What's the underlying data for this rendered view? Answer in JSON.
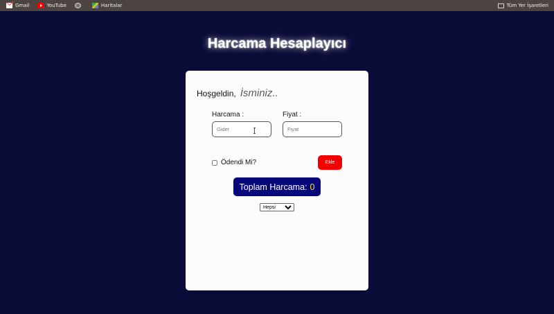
{
  "bookmarks": {
    "items": [
      {
        "label": "Gmail",
        "icon": "gmail-icon"
      },
      {
        "label": "YouTube",
        "icon": "youtube-icon"
      },
      {
        "label": "",
        "icon": "globe-icon"
      },
      {
        "label": "Haritalar",
        "icon": "maps-icon"
      }
    ],
    "all_bookmarks_label": "Tüm Yer İşaretleri"
  },
  "page_title": "Harcama Hesaplayıcı",
  "form": {
    "greeting_label": "Hoşgeldin,",
    "name_placeholder": "İsminiz..",
    "expense_label": "Harcama :",
    "expense_placeholder": "Gider",
    "price_label": "Fiyat :",
    "price_placeholder": "Fiyat",
    "paid_label": "Ödendi Mi?",
    "add_label": "Ekle",
    "total_label": "Toplam Harcama:",
    "total_value": "0",
    "filter_options": [
      "Hepsi"
    ],
    "filter_selected": "Hepsi"
  },
  "colors": {
    "background": "#0a0c38",
    "add_button": "#f50000",
    "total_box": "#06087a",
    "total_value": "#ffea00"
  }
}
